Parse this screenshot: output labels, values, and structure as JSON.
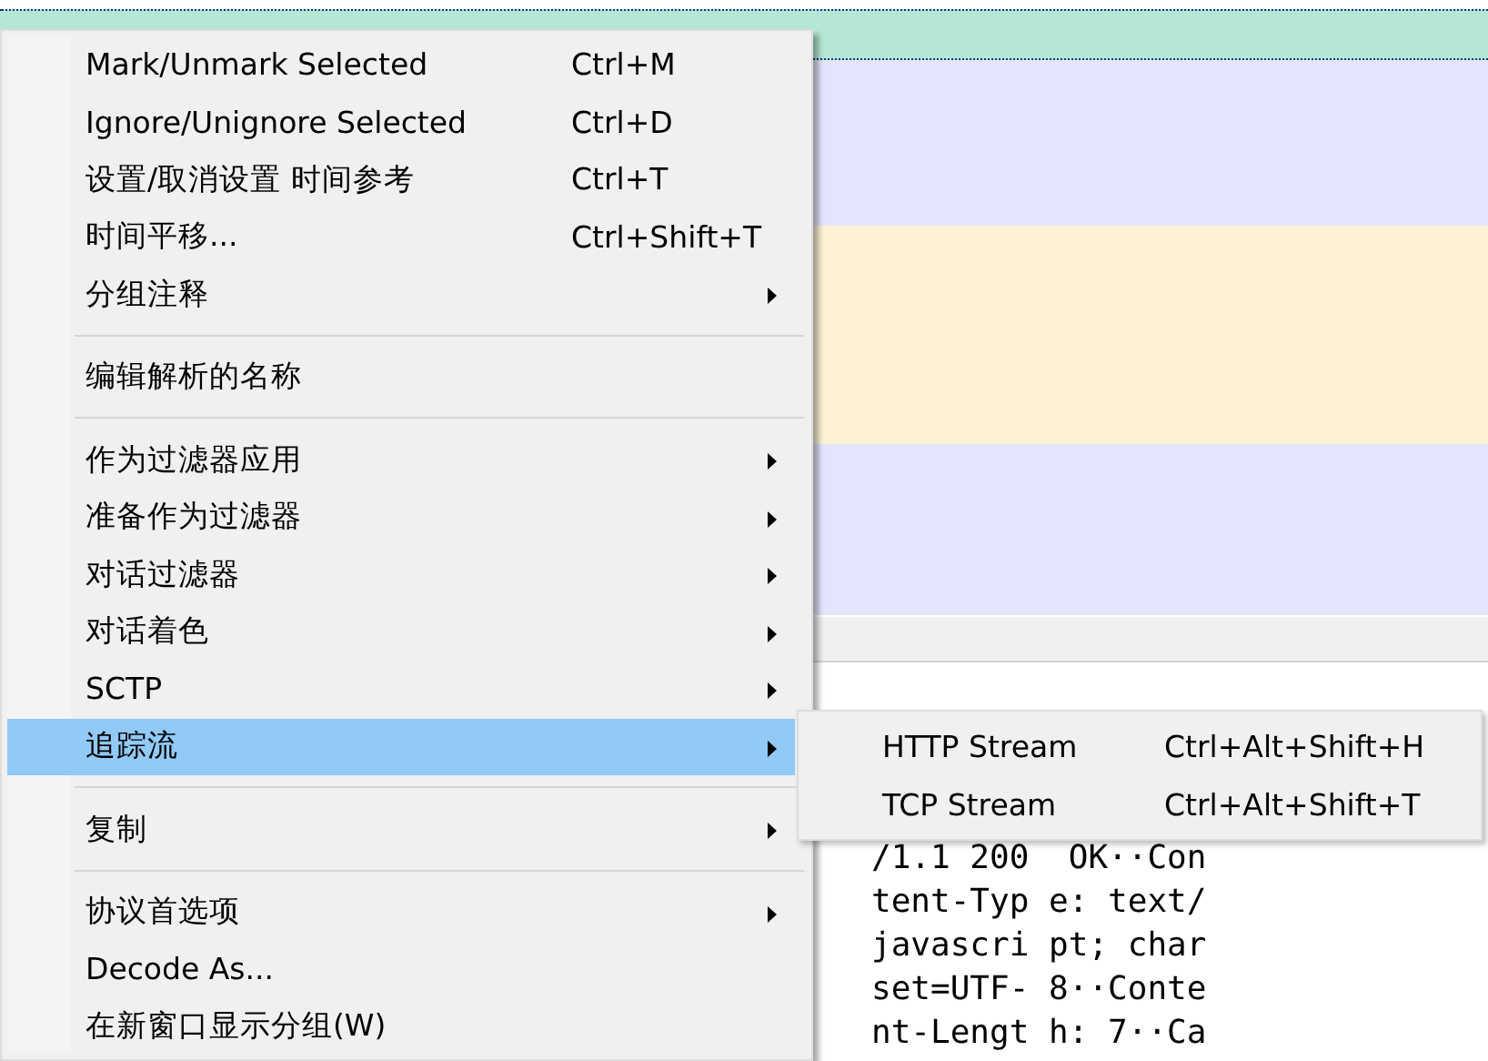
{
  "packet_rows": [
    {
      "color": "#b5e8d4",
      "selected": true
    },
    {
      "color": "#e4e4fc",
      "selected": false
    },
    {
      "color": "#fdf2d6",
      "selected": false
    },
    {
      "color": "#e4e4fc",
      "selected": false
    }
  ],
  "hex_pane": {
    "lines": [
      "/1.1 200  OK··Con",
      "tent-Typ e: text/",
      "javascri pt; char",
      "set=UTF- 8··Conte",
      "nt-Lengt h: 7··Ca"
    ]
  },
  "context_menu": {
    "items": [
      {
        "kind": "item",
        "label": "Mark/Unmark Selected",
        "shortcut": "Ctrl+M",
        "has_submenu": false,
        "selected": false
      },
      {
        "kind": "item",
        "label": "Ignore/Unignore Selected",
        "shortcut": "Ctrl+D",
        "has_submenu": false,
        "selected": false
      },
      {
        "kind": "item",
        "label": "设置/取消设置 时间参考",
        "shortcut": "Ctrl+T",
        "has_submenu": false,
        "selected": false
      },
      {
        "kind": "item",
        "label": "时间平移...",
        "shortcut": "Ctrl+Shift+T",
        "has_submenu": false,
        "selected": false
      },
      {
        "kind": "item",
        "label": "分组注释",
        "has_submenu": true,
        "selected": false
      },
      {
        "kind": "separator"
      },
      {
        "kind": "item",
        "label": "编辑解析的名称",
        "has_submenu": false,
        "selected": false
      },
      {
        "kind": "separator"
      },
      {
        "kind": "item",
        "label": "作为过滤器应用",
        "has_submenu": true,
        "selected": false
      },
      {
        "kind": "item",
        "label": "准备作为过滤器",
        "has_submenu": true,
        "selected": false
      },
      {
        "kind": "item",
        "label": "对话过滤器",
        "has_submenu": true,
        "selected": false
      },
      {
        "kind": "item",
        "label": "对话着色",
        "has_submenu": true,
        "selected": false
      },
      {
        "kind": "item",
        "label": "SCTP",
        "has_submenu": true,
        "selected": false
      },
      {
        "kind": "item",
        "label": "追踪流",
        "has_submenu": true,
        "selected": true
      },
      {
        "kind": "separator"
      },
      {
        "kind": "item",
        "label": "复制",
        "has_submenu": true,
        "selected": false
      },
      {
        "kind": "separator"
      },
      {
        "kind": "item",
        "label": "协议首选项",
        "has_submenu": true,
        "selected": false
      },
      {
        "kind": "item",
        "label": "Decode As...",
        "has_submenu": false,
        "selected": false
      },
      {
        "kind": "item",
        "label": "在新窗口显示分组(W)",
        "has_submenu": false,
        "selected": false
      }
    ]
  },
  "submenu": {
    "items": [
      {
        "label": "HTTP Stream",
        "shortcut": "Ctrl+Alt+Shift+H",
        "selected": false
      },
      {
        "label": "TCP Stream",
        "shortcut": "Ctrl+Alt+Shift+T",
        "selected": false
      }
    ]
  }
}
